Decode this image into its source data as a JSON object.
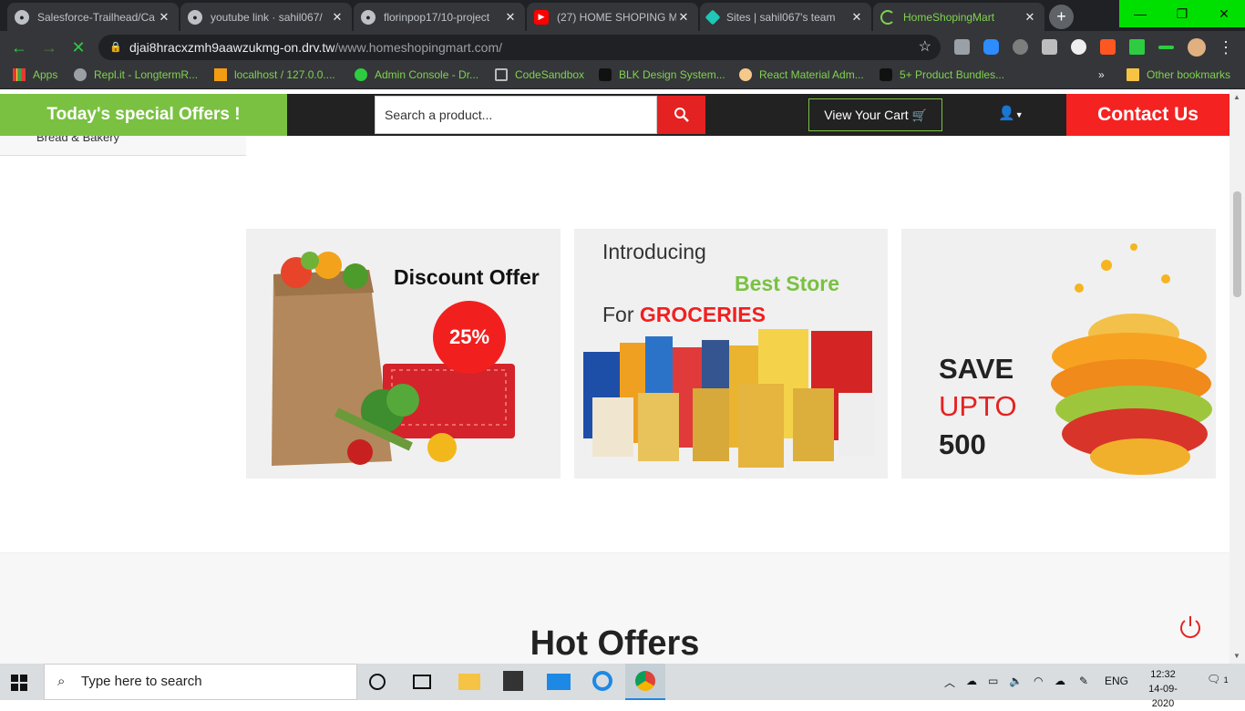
{
  "browser": {
    "tabs": [
      {
        "label": "Salesforce-Trailhead/Ca",
        "icon": "github-icon"
      },
      {
        "label": "youtube link · sahil067/",
        "icon": "github-icon"
      },
      {
        "label": "florinpop17/10-project",
        "icon": "github-icon"
      },
      {
        "label": "(27) HOME SHOPING M",
        "icon": "youtube-icon"
      },
      {
        "label": "Sites | sahil067's team",
        "icon": "netlify-icon"
      },
      {
        "label": "HomeShopingMart",
        "icon": "loading-icon"
      }
    ],
    "close_glyph": "✕",
    "new_tab_glyph": "+",
    "window_controls": {
      "minimize": "—",
      "restore": "❐",
      "close": "✕"
    },
    "url_host": "djai8hracxzmh9aawzukmg-on.drv.tw",
    "url_path": "/www.homeshopingmart.com/",
    "bookmarks": [
      {
        "label": "Apps"
      },
      {
        "label": "Repl.it - LongtermR..."
      },
      {
        "label": "localhost / 127.0.0...."
      },
      {
        "label": "Admin Console - Dr..."
      },
      {
        "label": "CodeSandbox"
      },
      {
        "label": "BLK Design System..."
      },
      {
        "label": "React Material Adm..."
      },
      {
        "label": "5+ Product Bundles..."
      }
    ],
    "bookmarks_overflow": "»",
    "other_bookmarks": "Other bookmarks"
  },
  "site": {
    "offer_bar": "Today's special Offers !",
    "search_placeholder": "Search a product...",
    "cart_label": "View Your Cart",
    "contact_label": "Contact Us",
    "sidebar_partial": "Bread & Bakery",
    "banners": {
      "discount": {
        "title": "Discount Offer",
        "percent": "25%"
      },
      "store": {
        "line1": "Introducing",
        "line2": "Best Store",
        "line3_prefix": "For",
        "line3_highlight": "GROCERIES"
      },
      "save": {
        "line1": "SAVE",
        "line2": "UPTO",
        "line3": "500"
      }
    },
    "hot_offers_title": "Hot Offers"
  },
  "taskbar": {
    "search_placeholder": "Type here to search",
    "language": "ENG",
    "time": "12:32",
    "date": "14-09-2020",
    "notification_count": "1"
  },
  "colors": {
    "accent_green": "#7ac142",
    "accent_red": "#f52222",
    "header_dark": "#222222"
  }
}
